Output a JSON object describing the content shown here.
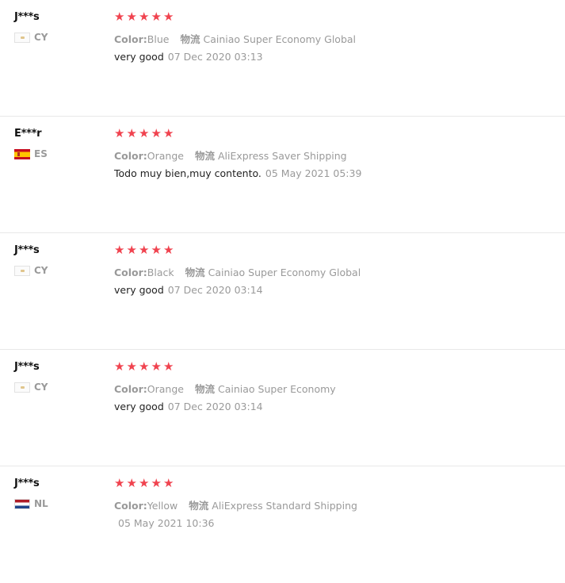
{
  "reviews": [
    {
      "user": "J***s",
      "country": "CY",
      "stars": 5,
      "color_label": "Color:",
      "color_value": "Blue",
      "shipping_label": "物流",
      "shipping_value": "Cainiao Super Economy Global",
      "text": "very good",
      "date": "07 Dec 2020 03:13"
    },
    {
      "user": "E***r",
      "country": "ES",
      "stars": 5,
      "color_label": "Color:",
      "color_value": "Orange",
      "shipping_label": "物流",
      "shipping_value": "AliExpress Saver Shipping",
      "text": "Todo muy bien,muy contento.",
      "date": "05 May 2021 05:39"
    },
    {
      "user": "J***s",
      "country": "CY",
      "stars": 5,
      "color_label": "Color:",
      "color_value": "Black",
      "shipping_label": "物流",
      "shipping_value": "Cainiao Super Economy Global",
      "text": "very good",
      "date": "07 Dec 2020 03:14"
    },
    {
      "user": "J***s",
      "country": "CY",
      "stars": 5,
      "color_label": "Color:",
      "color_value": "Orange",
      "shipping_label": "物流",
      "shipping_value": "Cainiao Super Economy",
      "text": "very good",
      "date": "07 Dec 2020 03:14"
    },
    {
      "user": "J***s",
      "country": "NL",
      "stars": 5,
      "color_label": "Color:",
      "color_value": "Yellow",
      "shipping_label": "物流",
      "shipping_value": "AliExpress Standard Shipping",
      "text": "",
      "date": "05 May 2021 10:36"
    }
  ],
  "star_glyph": "★",
  "colors": {
    "star": "#f0434f",
    "muted": "#9a9a9a",
    "divider": "#e8e8e8"
  }
}
